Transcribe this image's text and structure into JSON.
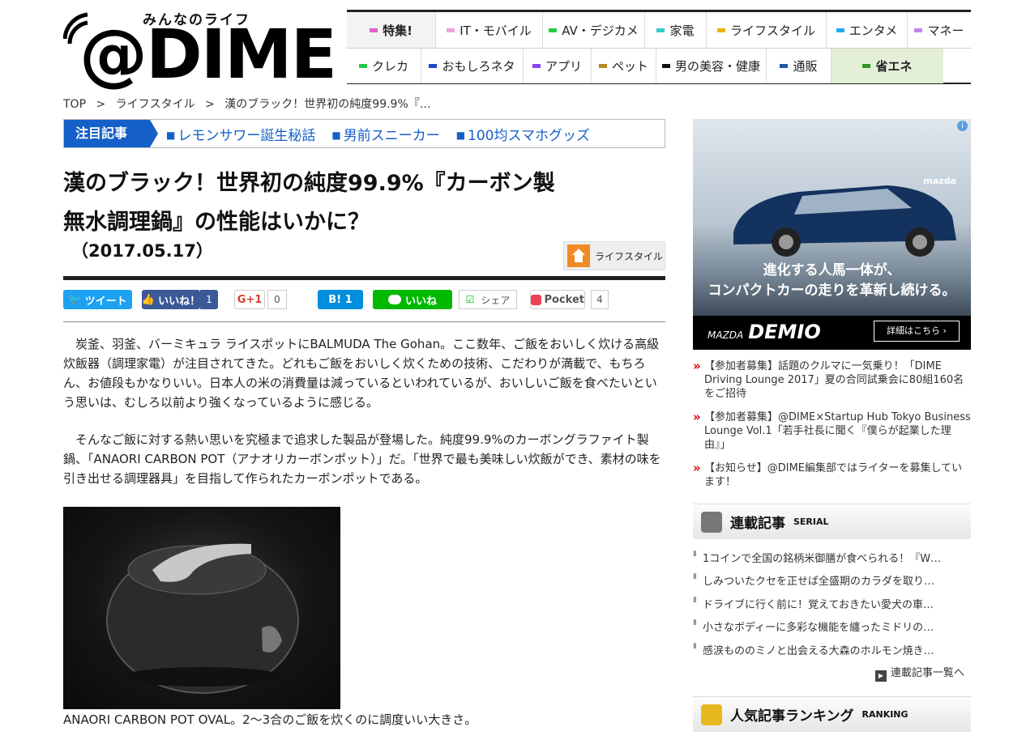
{
  "logo": {
    "tagline": "みんなのライフ",
    "wordmark": "@DIME"
  },
  "nav": {
    "row1": [
      {
        "label": "特集!",
        "color": "#e060d0"
      },
      {
        "label": "IT・モバイル",
        "color": "#f0a0e0"
      },
      {
        "label": "AV・デジカメ",
        "color": "#22cc44"
      },
      {
        "label": "家電",
        "color": "#33cccc"
      },
      {
        "label": "ライフスタイル",
        "color": "#f0b000"
      },
      {
        "label": "エンタメ",
        "color": "#22aaee"
      },
      {
        "label": "マネー",
        "color": "#bb88ee"
      }
    ],
    "row2": [
      {
        "label": "クレカ",
        "color": "#22cc44"
      },
      {
        "label": "おもしろネタ",
        "color": "#2244cc"
      },
      {
        "label": "アプリ",
        "color": "#8844ee"
      },
      {
        "label": "ペット",
        "color": "#bb8822"
      },
      {
        "label": "男の美容・健康",
        "color": "#111111"
      },
      {
        "label": "通販",
        "color": "#2255aa"
      },
      {
        "label": "省エネ",
        "color": "#339922"
      }
    ]
  },
  "breadcrumb": {
    "top": "TOP",
    "sep": ">",
    "category": "ライフスタイル",
    "current": "漢のブラック！世界初の純度99.9%『…"
  },
  "featured": {
    "label": "注目記事",
    "links": [
      "レモンサワー誕生秘話",
      "男前スニーカー",
      "100均スマホグッズ"
    ]
  },
  "article": {
    "title": "漢のブラック！世界初の純度99.9%『カーボン製無水調理鍋』の性能はいかに？",
    "date": "（2017.05.17）",
    "category_badge": "ライフスタイル",
    "p1": "　炭釜、羽釜、バーミキュラ ライスポットにBALMUDA The Gohan。ここ数年、ご飯をおいしく炊ける高級炊飯器（調理家電）が注目されてきた。どれもご飯をおいしく炊くための技術、こだわりが満載で、もちろん、お値段もかなりいい。日本人の米の消費量は減っているといわれているが、おいしいご飯を食べたいという思いは、むしろ以前より強くなっているように感じる。",
    "p2": "　そんなご飯に対する熱い思いを究極まで追求した製品が登場した。純度99.9%のカーボングラファイト製鍋、「ANAORI CARBON POT（アナオリカーボンポット）」だ。「世界で最も美味しい炊飯ができ、素材の味を引き出せる調理器具」を目指して作られたカーボンポットである。",
    "caption": "ANAORI CARBON POT OVAL。2〜3合のご飯を炊くのに調度いい大きさ。"
  },
  "share": {
    "tweet": "ツイート",
    "like": "いいね！",
    "like_count": "1",
    "gplus": "G+1",
    "gplus_count": "0",
    "hatena": "B! 1",
    "line": "いいね",
    "line_share": "シェア",
    "pocket": "Pocket",
    "pocket_count": "4"
  },
  "ad": {
    "info": "i",
    "brand": "mazda",
    "copy_line1": "進化する人馬一体が、",
    "copy_line2": "コンパクトカーの走りを革新し続ける。",
    "model_maker": "MAZDA",
    "model": "DEMIO",
    "more": "詳細はこちら ›"
  },
  "news": [
    "【参加者募集】話題のクルマに一気乗り！「DIME Driving Lounge 2017」夏の合同試乗会に80組160名をご招待",
    "【参加者募集】@DIME×Startup Hub Tokyo Business Lounge Vol.1「若手社長に聞く『僕らが起業した理由』」",
    "【お知らせ】@DIME編集部ではライターを募集しています！"
  ],
  "serial": {
    "title": "連載記事",
    "title_en": "SERIAL",
    "items": [
      "1コインで全国の銘柄米御膳が食べられる！『W…",
      "しみついたクセを正せば全盛期のカラダを取り…",
      "ドライブに行く前に！覚えておきたい愛犬の車…",
      "小さなボディーに多彩な機能を纏ったミドリの…",
      "感涙もののミノと出会える大森のホルモン焼き…"
    ],
    "more": "連載記事一覧へ"
  },
  "ranking": {
    "title": "人気記事ランキング",
    "title_en": "RANKING"
  }
}
